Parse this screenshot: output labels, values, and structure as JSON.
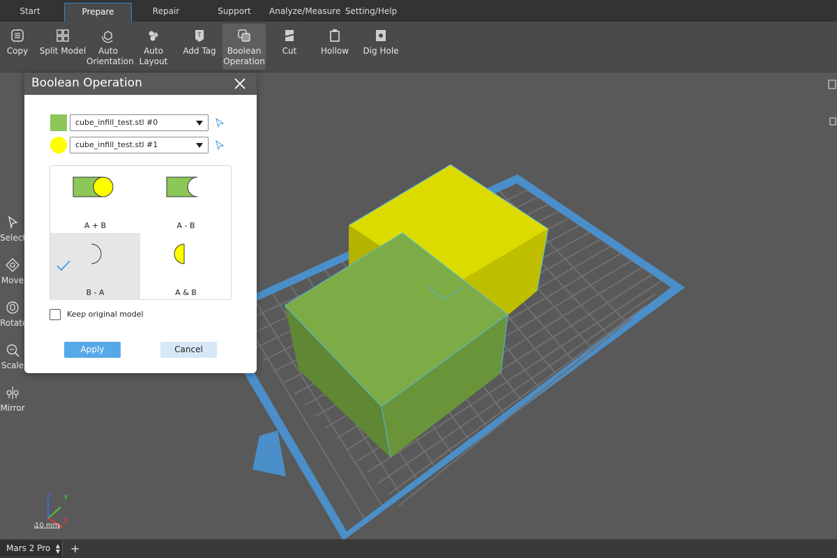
{
  "tabs": [
    {
      "label": "Start"
    },
    {
      "label": "Prepare"
    },
    {
      "label": "Repair"
    },
    {
      "label": "Support"
    },
    {
      "label": "Analyze/Measure"
    },
    {
      "label": "Setting/Help"
    }
  ],
  "toolbar": {
    "copy": "Copy",
    "split_model": "Split Model",
    "auto_orientation_1": "Auto",
    "auto_orientation_2": "Orientation",
    "auto_layout": "Auto Layout",
    "add_tag": "Add Tag",
    "boolean_1": "Boolean",
    "boolean_2": "Operation",
    "cut": "Cut",
    "hollow": "Hollow",
    "dig_hole": "Dig Hole"
  },
  "left_tools": {
    "select": "Select",
    "move": "Move",
    "rotate": "Rotate",
    "scale": "Scale",
    "mirror": "Mirror"
  },
  "dialog": {
    "title": "Boolean Operation",
    "model_a": "cube_infill_test.stl #0",
    "model_b": "cube_infill_test.stl #1",
    "ops": {
      "union": "A + B",
      "a_minus_b": "A - B",
      "b_minus_a": "B - A",
      "intersection": "A & B"
    },
    "selected_op": "B - A",
    "keep_original": "Keep original model",
    "apply": "Apply",
    "cancel": "Cancel"
  },
  "axes": {
    "z": "Z",
    "y": "Y",
    "x": "X",
    "scale": "10 mm"
  },
  "bottom": {
    "printer": "Mars 2 Pro",
    "add": "+"
  },
  "colors": {
    "model_a": "#8cc757",
    "model_b": "#ffff00",
    "accent": "#2d86c9",
    "plate_border": "#4a8fc9"
  }
}
